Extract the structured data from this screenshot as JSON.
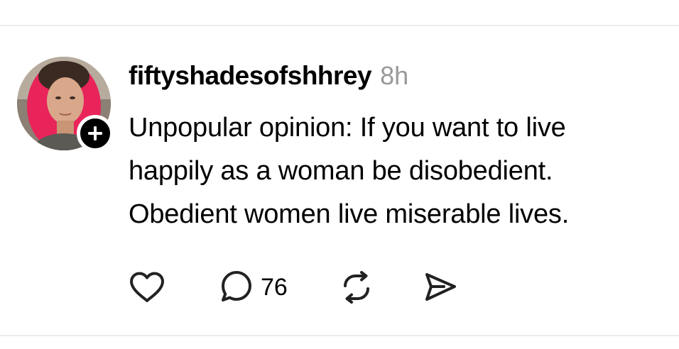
{
  "post": {
    "username": "fiftyshadesofshhrey",
    "timestamp": "8h",
    "text_lines": [
      "Unpopular opinion: If you want to live",
      "happily as a woman be disobedient.",
      "Obedient women live miserable lives."
    ]
  },
  "actions": {
    "like_icon": "heart-icon",
    "reply_icon": "comment-bubble-icon",
    "reply_count": "76",
    "repost_icon": "repost-icon",
    "share_icon": "send-icon"
  },
  "avatar": {
    "follow_icon": "plus-icon"
  },
  "colors": {
    "text": "#000000",
    "muted": "#999999",
    "divider": "#ececec",
    "hair": "#e8245a"
  }
}
